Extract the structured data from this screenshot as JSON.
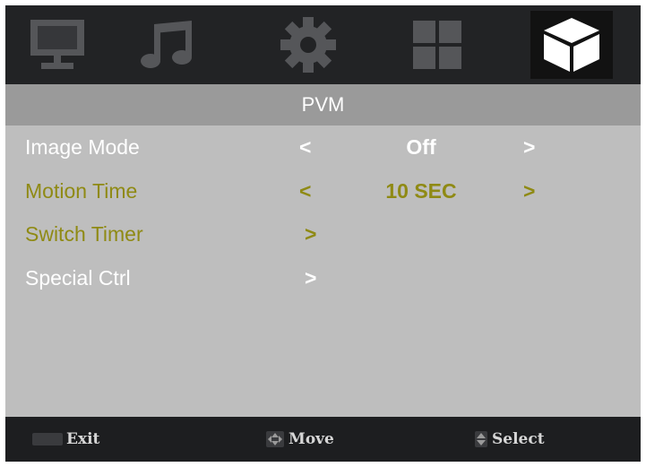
{
  "tabs": [
    {
      "icon": "monitor-icon",
      "active": false
    },
    {
      "icon": "music-note-icon",
      "active": false
    },
    {
      "icon": "gear-icon",
      "active": false
    },
    {
      "icon": "grid-icon",
      "active": false
    },
    {
      "icon": "cube-icon",
      "active": true
    }
  ],
  "menu": {
    "title": "PVM",
    "rows": [
      {
        "label": "Image Mode",
        "left_arrow": "<",
        "value": "Off",
        "right_arrow": ">"
      },
      {
        "label": "Motion Time",
        "left_arrow": "<",
        "value": "10 SEC",
        "right_arrow": ">"
      },
      {
        "label": "Switch Timer",
        "submenu_arrow": ">"
      },
      {
        "label": "Special Ctrl",
        "submenu_arrow": ">"
      }
    ]
  },
  "footer": {
    "exit_label": "Exit",
    "move_label": "Move",
    "select_label": "Select"
  },
  "colors": {
    "background": "#bebebe",
    "header_bar": "#222325",
    "title_strip": "#9a9a9a",
    "highlight_text": "#8f8a14",
    "normal_text": "#ffffff",
    "footer_bar": "#1d1e20"
  }
}
